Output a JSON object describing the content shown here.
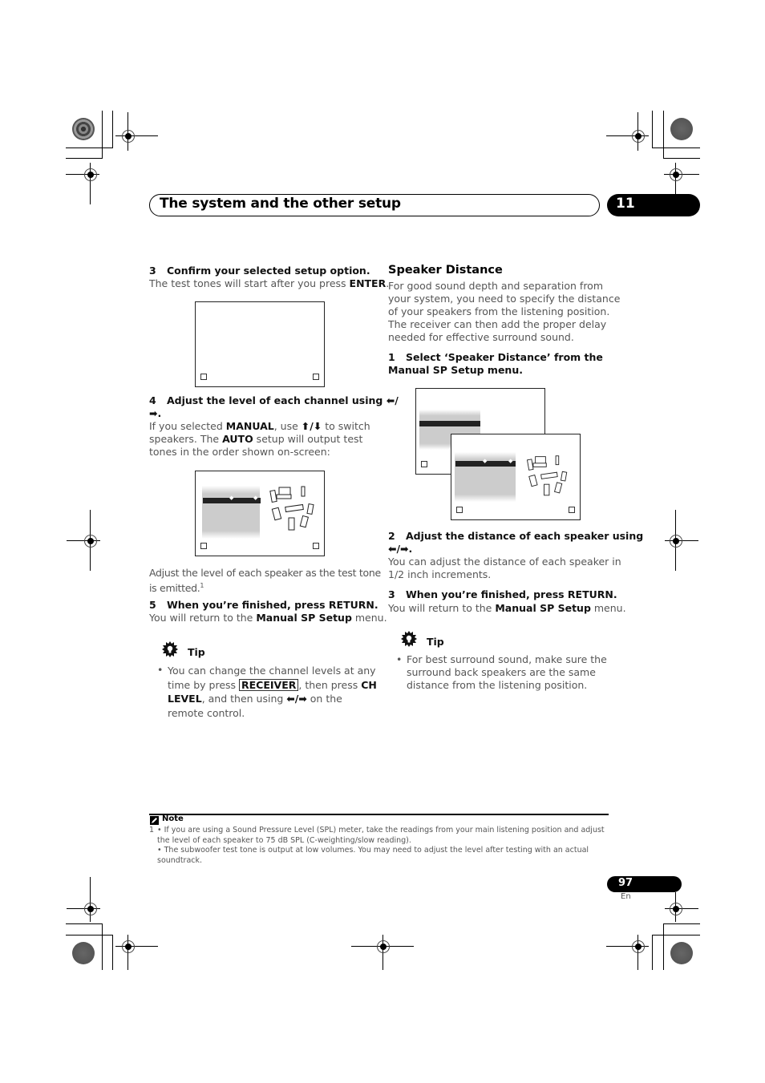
{
  "header": {
    "section_title": "The system and the other setup",
    "chapter_number": "11"
  },
  "left_column": {
    "step3": {
      "number": "3",
      "title": "Confirm your selected setup option.",
      "body_pre": "The test tones will start after you press ",
      "body_key": "ENTER",
      "body_post": "."
    },
    "step4": {
      "number": "4",
      "title_line1": "Adjust the level of each channel using ⬅/",
      "title_line2": "➡.",
      "body_l1_pre": "If you selected ",
      "body_l1_key": "MANUAL",
      "body_l1_mid": ", use ",
      "body_l1_arrows": "⬆/⬇",
      "body_l1_post": " to switch",
      "body_l2_pre": "speakers. The ",
      "body_l2_key": "AUTO",
      "body_l2_post": " setup will output test",
      "body_l3": "tones in the order shown on-screen:"
    },
    "after_screen": {
      "line1": "Adjust the level of each speaker as the test tone",
      "line2": "is emitted.",
      "footnote_ref": "1"
    },
    "step5": {
      "number": "5",
      "title": "When you’re finished, press RETURN.",
      "body_pre": "You will return to the ",
      "body_key": "Manual SP Setup",
      "body_post": " menu."
    },
    "tip": {
      "title": "Tip",
      "bullet": "•",
      "l1": "You can change the channel levels at any",
      "l2_pre": "time by press ",
      "l2_key": "RECEIVER",
      "l2_mid": ", then press ",
      "l2_key2": "CH",
      "l3_key": "LEVEL",
      "l3_mid": ", and then using ",
      "l3_arrows": "⬅/➡",
      "l3_post": " on the",
      "l4": "remote control."
    }
  },
  "right_column": {
    "heading": "Speaker Distance",
    "intro": [
      "For good sound depth and separation from",
      "your system, you need to specify the distance",
      "of your speakers from the listening position.",
      "The receiver can then add the proper delay",
      "needed for effective surround sound."
    ],
    "step1": {
      "number": "1",
      "title_line1": "Select ‘Speaker Distance’ from the",
      "title_line2": "Manual SP Setup menu."
    },
    "step2": {
      "number": "2",
      "title_line1": "Adjust the distance of each speaker using",
      "title_line2": "⬅/➡.",
      "body_line1": "You can adjust the distance of each speaker in",
      "body_line2": "1/2 inch increments."
    },
    "step3": {
      "number": "3",
      "title": "When you’re finished, press RETURN.",
      "body_pre": "You will return to the ",
      "body_key": "Manual SP Setup",
      "body_post": " menu."
    },
    "tip": {
      "title": "Tip",
      "bullet": "•",
      "lines": [
        "For best surround sound, make sure the",
        "surround back speakers are the same",
        "distance from the listening position."
      ]
    }
  },
  "note": {
    "label": "Note",
    "number": "1",
    "l1": "• If you are using a Sound Pressure Level (SPL) meter, take the readings from your main listening position and adjust",
    "l2": "the level of each speaker to 75 dB SPL (C-weighting/slow reading).",
    "l3": "• The subwoofer test tone is output at low volumes. You may need to adjust the level after testing with an actual",
    "l4": "soundtrack."
  },
  "footer": {
    "page_number": "97",
    "language": "En"
  },
  "icons": {
    "tip": "lightbulb-gear-icon",
    "note": "pencil-icon",
    "screen_corner": "screen-corner-icon",
    "selector_arrow": "◆"
  }
}
